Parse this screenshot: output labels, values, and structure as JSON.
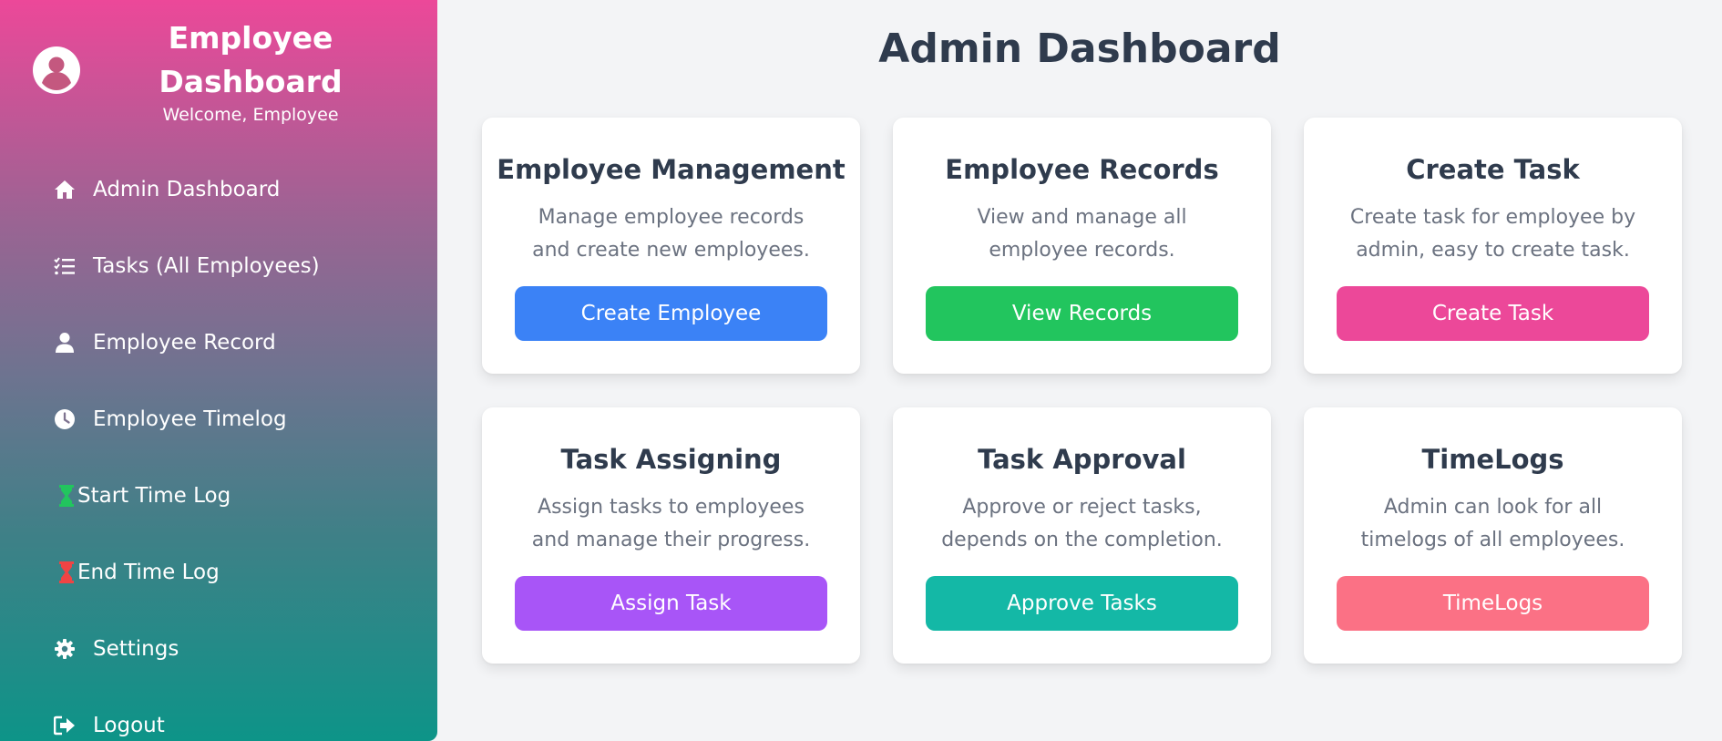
{
  "sidebar": {
    "title": "Employee Dashboard",
    "welcome": "Welcome, Employee",
    "items": [
      {
        "label": "Admin Dashboard",
        "icon": "home-icon"
      },
      {
        "label": "Tasks (All Employees)",
        "icon": "task-list-icon"
      },
      {
        "label": "Employee Record",
        "icon": "user-icon"
      },
      {
        "label": "Employee Timelog",
        "icon": "clock-icon"
      },
      {
        "label": "Start Time Log",
        "icon": "hourglass-green-icon"
      },
      {
        "label": "End Time Log",
        "icon": "hourglass-red-icon"
      },
      {
        "label": "Settings",
        "icon": "gear-icon"
      },
      {
        "label": "Logout",
        "icon": "logout-icon"
      }
    ],
    "gradient": [
      "#ec4899",
      "#0d9488"
    ]
  },
  "main": {
    "title": "Admin Dashboard",
    "cards": [
      {
        "title": "Employee Management",
        "description": "Manage employee records and create new employees.",
        "button": "Create Employee",
        "color": "#3b82f6"
      },
      {
        "title": "Employee Records",
        "description": "View and manage all employee records.",
        "button": "View Records",
        "color": "#22c55e"
      },
      {
        "title": "Create Task",
        "description": "Create task for employee by admin, easy to create task.",
        "button": "Create Task",
        "color": "#ec4899"
      },
      {
        "title": "Task Assigning",
        "description": "Assign tasks to employees and manage their progress.",
        "button": "Assign Task",
        "color": "#a855f7"
      },
      {
        "title": "Task Approval",
        "description": "Approve or reject tasks, depends on the completion.",
        "button": "Approve Tasks",
        "color": "#14b8a6"
      },
      {
        "title": "TimeLogs",
        "description": "Admin can look for all timelogs of all employees.",
        "button": "TimeLogs",
        "color": "#fb7185"
      }
    ]
  }
}
